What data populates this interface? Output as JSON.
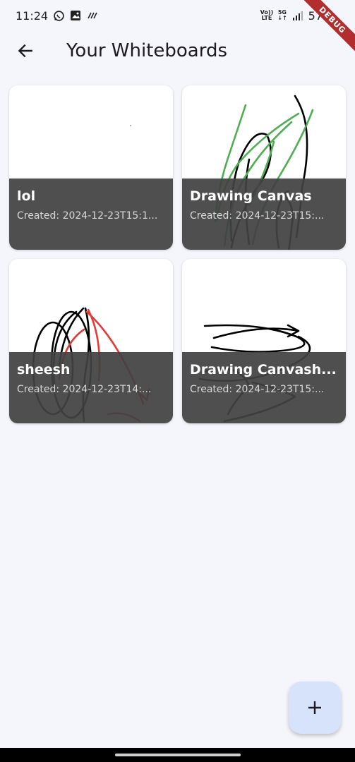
{
  "status_bar": {
    "time": "11:24",
    "left_icons": [
      "whatsapp-icon",
      "gallery-icon",
      "data-saver-icon"
    ],
    "network_labels": {
      "volte_top": "Vo))",
      "volte_bottom": "LTE",
      "fiveg_top": "5G",
      "fiveg_bottom": "↓↑"
    },
    "battery": "57"
  },
  "debug_banner": "DEBUG",
  "app_bar": {
    "back_icon": "arrow-back-icon",
    "title": "Your Whiteboards"
  },
  "whiteboards": [
    {
      "title": "lol",
      "created": "Created: 2024-12-23T15:1..."
    },
    {
      "title": "Drawing Canvas",
      "created": "Created: 2024-12-23T15:..."
    },
    {
      "title": "sheesh",
      "created": "Created: 2024-12-23T14:..."
    },
    {
      "title": "Drawing Canvash...",
      "created": "Created: 2024-12-23T15:..."
    }
  ],
  "fab": {
    "icon": "plus-icon"
  },
  "colors": {
    "background": "#f5f6fc",
    "card_footer": "#424242",
    "fab": "#d7e3fb",
    "stroke_green": "#4caf50",
    "stroke_red": "#e53935",
    "stroke_black": "#000000",
    "debug_ribbon": "#b22d2d"
  }
}
